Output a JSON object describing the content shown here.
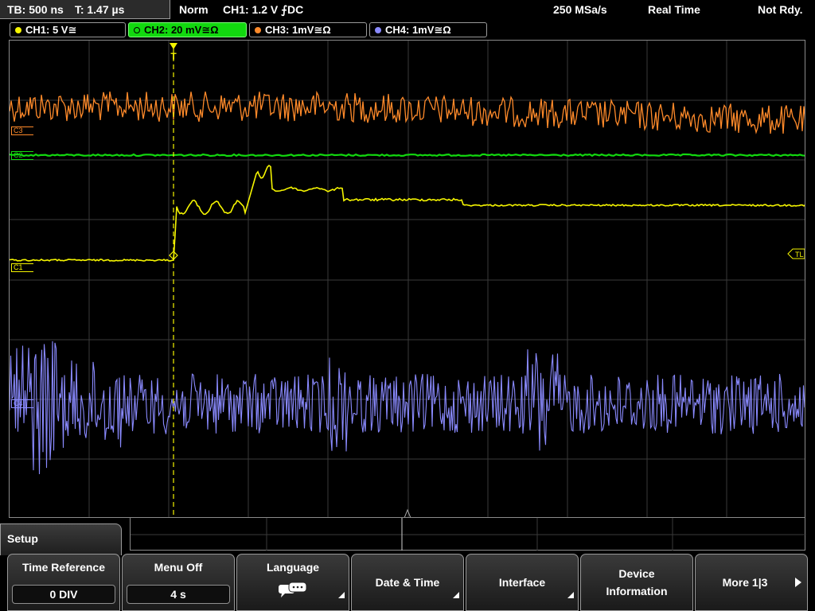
{
  "topbar": {
    "timebase": "TB: 500 ns",
    "trigger_time": "T: 1.47 µs",
    "trigger_mode": "Norm",
    "trigger_info": "CH1: 1.2 V ⨍DC",
    "sample_rate": "250 MSa/s",
    "acq_mode": "Real Time",
    "status": "Not Rdy."
  },
  "channels": [
    {
      "label": "CH1: 5 V≅",
      "color": "#f5f500"
    },
    {
      "label": "CH2: 20 mV≅Ω",
      "color": "#12d90f"
    },
    {
      "label": "CH3: 1mV≅Ω",
      "color": "#ff8a2a"
    },
    {
      "label": "CH4: 1mV≅Ω",
      "color": "#8a8aff"
    }
  ],
  "markers": {
    "c1": "C1",
    "c2": "C2",
    "c3": "C3",
    "c4": "C4",
    "trigger_level": "TL",
    "trigger_pos": "T"
  },
  "menu": {
    "title": "Setup",
    "time_reference": {
      "label": "Time Reference",
      "value": "0 DIV"
    },
    "menu_off": {
      "label": "Menu Off",
      "value": "4 s"
    },
    "language": {
      "label": "Language",
      "icon": "speech-bubbles-icon"
    },
    "date_time": {
      "label": "Date & Time"
    },
    "interface": {
      "label": "Interface"
    },
    "device_info": {
      "label_1": "Device",
      "label_2": "Information"
    },
    "more": {
      "label": "More 1|3"
    }
  },
  "colors": {
    "ch1": "#f5f500",
    "ch2": "#12d90f",
    "ch3": "#ff8a2a",
    "ch4": "#8a8aff",
    "grid": "#3a3a3a"
  }
}
